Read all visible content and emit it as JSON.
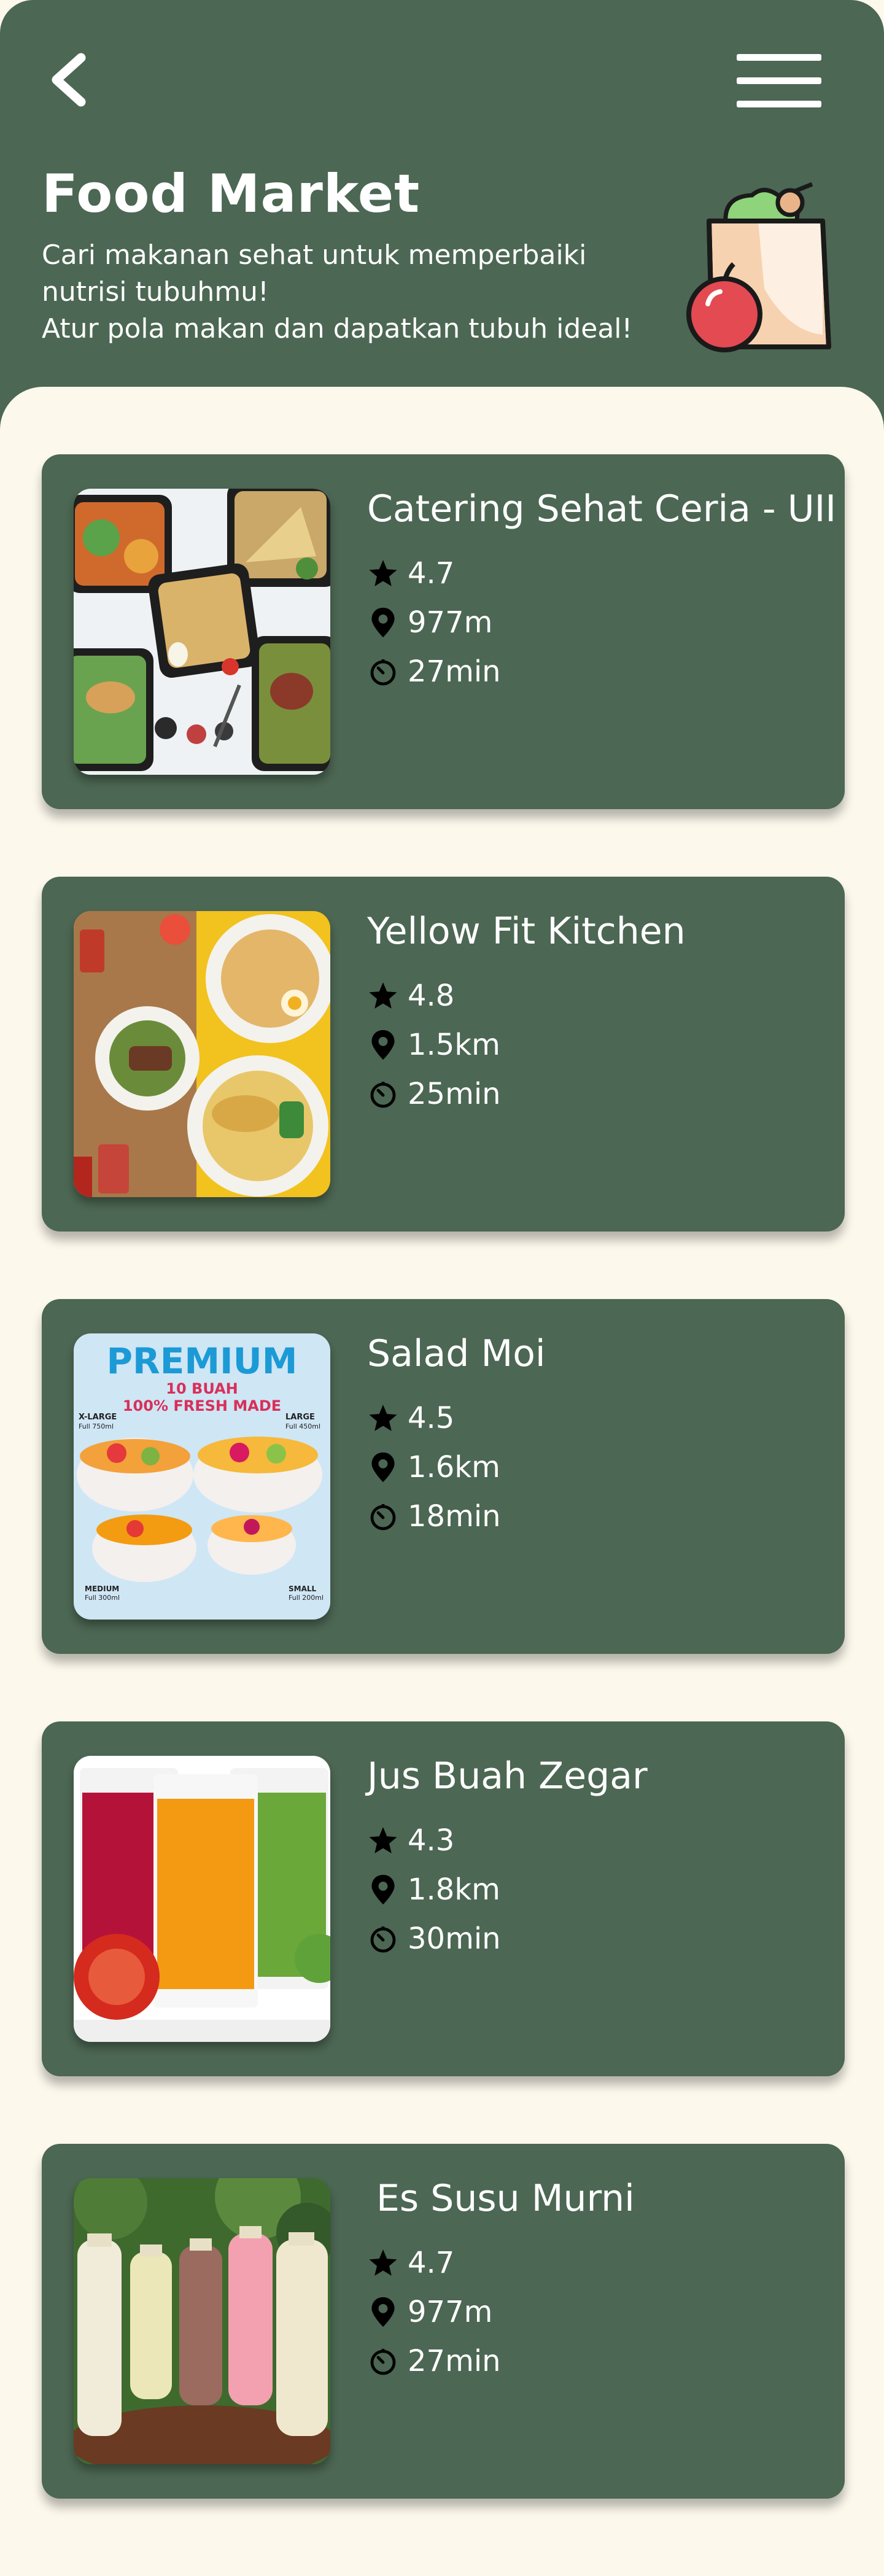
{
  "header": {
    "title": "Food Market",
    "subtitle_lines": [
      "Cari makanan sehat untuk memperbaiki",
      "nutrisi tubuhmu!",
      "Atur pola makan dan dapatkan tubuh ideal!"
    ],
    "back_icon": "chevron-left-icon",
    "menu_icon": "hamburger-menu-icon",
    "illustration_icon": "grocery-bag-apple-icon"
  },
  "theme": {
    "primary": "#4c6753",
    "background": "#fcf8ec",
    "text_on_primary": "#ffffff"
  },
  "restaurants": [
    {
      "name": "Catering Sehat Ceria - UII",
      "rating": "4.7",
      "distance": "977m",
      "time": "27min",
      "image": "meal-boxes"
    },
    {
      "name": "Yellow Fit Kitchen",
      "rating": "4.8",
      "distance": "1.5km",
      "time": "25min",
      "image": "plated-meals"
    },
    {
      "name": "Salad Moi",
      "rating": "4.5",
      "distance": "1.6km",
      "time": "18min",
      "image": "fruit-salad-cups",
      "image_texts": {
        "banner": "PREMIUM",
        "sub1": "10 BUAH",
        "sub2": "100% FRESH MADE",
        "xl": "X-LARGE",
        "xl_sub": "Full 750ml",
        "lg": "LARGE",
        "lg_sub": "Full 450ml",
        "md": "MEDIUM",
        "md_sub": "Full 300ml",
        "sm": "SMALL",
        "sm_sub": "Full 200ml"
      }
    },
    {
      "name": "Jus Buah Zegar",
      "rating": "4.3",
      "distance": "1.8km",
      "time": "30min",
      "image": "juice-glasses"
    },
    {
      "name": "Es Susu Murni",
      "rating": "4.7",
      "distance": "977m",
      "time": "27min",
      "image": "milk-bottles"
    }
  ],
  "meta_icons": {
    "rating": "star-icon",
    "distance": "location-pin-icon",
    "time": "timer-icon"
  }
}
